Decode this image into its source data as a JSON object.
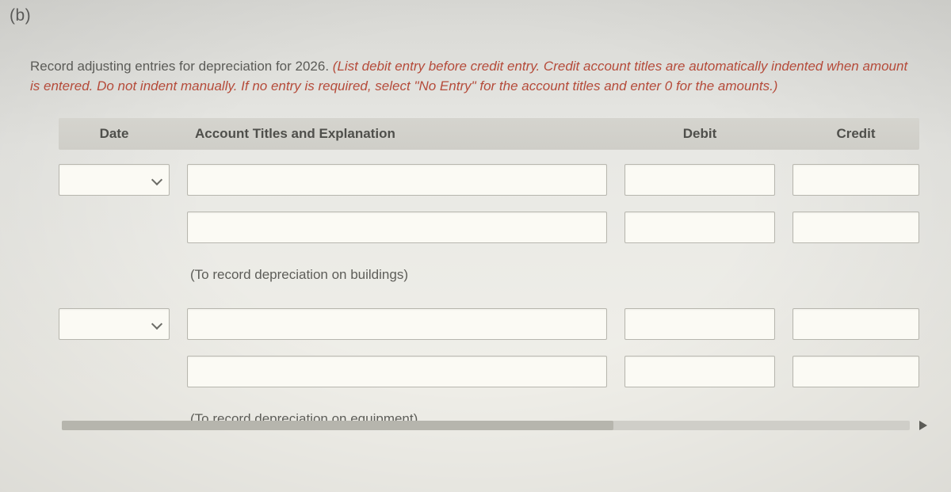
{
  "part_label": "(b)",
  "instructions": {
    "lead": "Record adjusting entries for depreciation for 2026. ",
    "italic": "(List debit entry before credit entry. Credit account titles are automatically indented when amount is entered. Do not indent manually. If no entry is required, select \"No Entry\" for the account titles and enter 0 for the amounts.)"
  },
  "headers": {
    "date": "Date",
    "account": "Account Titles and Explanation",
    "debit": "Debit",
    "credit": "Credit"
  },
  "entries": [
    {
      "show_date_select": true,
      "rows": [
        {
          "account": "",
          "debit": "",
          "credit": ""
        },
        {
          "account": "",
          "debit": "",
          "credit": ""
        }
      ],
      "caption": "(To record depreciation on buildings)"
    },
    {
      "show_date_select": true,
      "rows": [
        {
          "account": "",
          "debit": "",
          "credit": ""
        },
        {
          "account": "",
          "debit": "",
          "credit": ""
        }
      ],
      "caption": "(To record depreciation on equipment)"
    }
  ]
}
